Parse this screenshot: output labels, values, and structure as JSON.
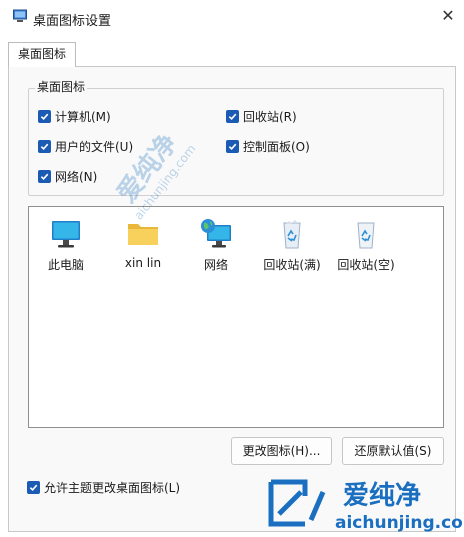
{
  "window": {
    "title": "桌面图标设置"
  },
  "tabs": [
    {
      "label": "桌面图标"
    }
  ],
  "desktop_icons": {
    "group_label": "桌面图标",
    "checkboxes": [
      {
        "label": "计算机(M)",
        "checked": true
      },
      {
        "label": "回收站(R)",
        "checked": true
      },
      {
        "label": "用户的文件(U)",
        "checked": true
      },
      {
        "label": "控制面板(O)",
        "checked": true
      },
      {
        "label": "网络(N)",
        "checked": true
      }
    ]
  },
  "icon_list": [
    {
      "label": "此电脑",
      "icon": "monitor-icon"
    },
    {
      "label": "xin lin",
      "icon": "folder-icon"
    },
    {
      "label": "网络",
      "icon": "network-globe-icon"
    },
    {
      "label": "回收站(满)",
      "icon": "recycle-bin-full-icon"
    },
    {
      "label": "回收站(空)",
      "icon": "recycle-bin-empty-icon"
    }
  ],
  "buttons": {
    "change_icon": "更改图标(H)...",
    "restore_default": "还原默认值(S)"
  },
  "theme_checkbox": {
    "label": "允许主题更改桌面图标(L)",
    "checked": true
  },
  "watermark": {
    "text": "爱纯净",
    "url": "aichunjing.com"
  },
  "colors": {
    "accent": "#1c5bb4",
    "watermark": "#1a6fc0"
  }
}
